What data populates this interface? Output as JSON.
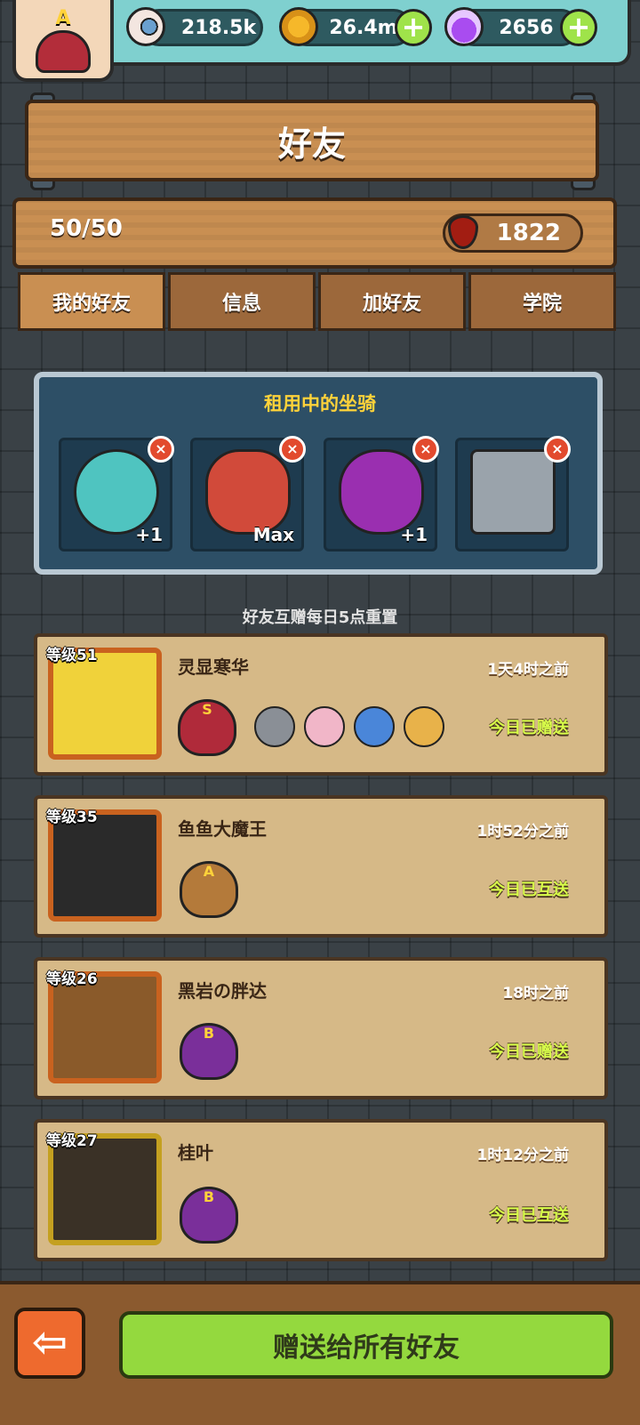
{
  "header": {
    "player_rank": "A",
    "resources": [
      {
        "name": "eyeball",
        "icon": "eyeball-icon",
        "value": "218.5k"
      },
      {
        "name": "coin",
        "icon": "coin-icon",
        "value": "26.4m"
      },
      {
        "name": "potion",
        "icon": "potion-icon",
        "value": "2656"
      }
    ],
    "add_symbol": "+"
  },
  "page": {
    "title": "好友",
    "friend_count": "50/50",
    "blood_value": "1822"
  },
  "tabs": [
    {
      "label": "我的好友",
      "active": true
    },
    {
      "label": "信息",
      "active": false
    },
    {
      "label": "加好友",
      "active": false
    },
    {
      "label": "学院",
      "active": false
    }
  ],
  "mounts": {
    "title": "租用中的坐骑",
    "remove_symbol": "×",
    "items": [
      {
        "label": "+1",
        "color": "#4fc4c0"
      },
      {
        "label": "Max",
        "color": "#d14a3a"
      },
      {
        "label": "+1",
        "color": "#9a2fb0"
      },
      {
        "label": "",
        "color": "#9aa3ab"
      }
    ]
  },
  "reset_note": "好友互赠每日5点重置",
  "friends": [
    {
      "level": "等级51",
      "name": "灵显寒华",
      "time": "1天4时之前",
      "status": "今日已赠送",
      "rank": "S",
      "portrait_color": "#f0d23a"
    },
    {
      "level": "等级35",
      "name": "鱼鱼大魔王",
      "time": "1时52分之前",
      "status": "今日已互送",
      "rank": "A",
      "portrait_color": "#2a2a2a"
    },
    {
      "level": "等级26",
      "name": "黑岩の胖达",
      "time": "18时之前",
      "status": "今日已赠送",
      "rank": "B",
      "portrait_color": "#8a5a2a"
    },
    {
      "level": "等级27",
      "name": "桂叶",
      "time": "1时12分之前",
      "status": "今日已互送",
      "rank": "B",
      "portrait_color": "#3a3126"
    }
  ],
  "footer": {
    "back_symbol": "⇦",
    "gift_all_label": "赠送给所有好友"
  }
}
